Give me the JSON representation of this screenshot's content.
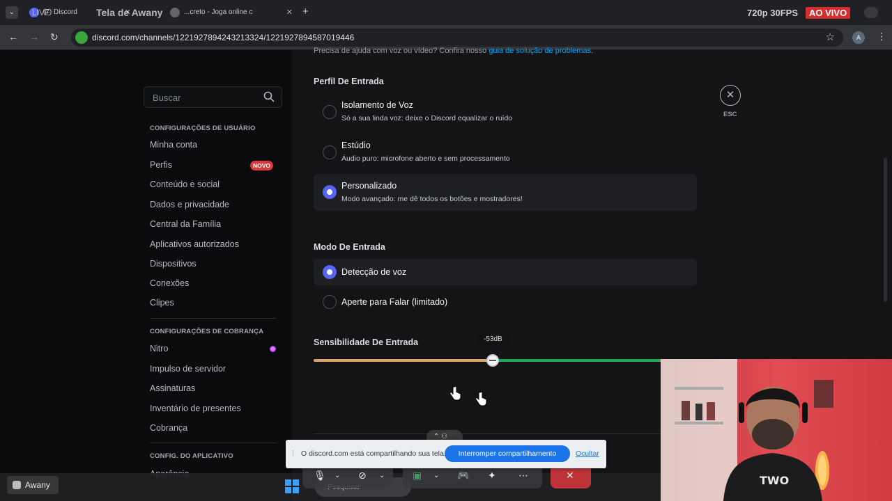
{
  "browser": {
    "live_label": "LIVE",
    "stream_title": "Tela de Awany",
    "tabs": [
      {
        "label": "(7) Discord"
      },
      {
        "label": "..."
      },
      {
        "label": "...creto - Joga online c"
      }
    ],
    "quality": "720p 30FPS",
    "live_badge": "AO VIVO",
    "url": "discord.com/channels/1221927894243213324/1221927894587019446",
    "account_initial": "A",
    "icons": [
      "back-icon",
      "forward-icon",
      "reload-icon",
      "star-icon",
      "kebab-icon"
    ]
  },
  "sidebar": {
    "search_placeholder": "Buscar",
    "sections": [
      {
        "header": "CONFIGURAÇÕES DE USUÁRIO",
        "items": [
          "Minha conta",
          "Perfis",
          "Conteúdo e social",
          "Dados e privacidade",
          "Central da Família",
          "Aplicativos autorizados",
          "Dispositivos",
          "Conexões",
          "Clipes"
        ]
      },
      {
        "header": "CONFIGURAÇÕES DE COBRANÇA",
        "items": [
          "Nitro",
          "Impulso de servidor",
          "Assinaturas",
          "Inventário de presentes",
          "Cobrança"
        ]
      },
      {
        "header": "CONFIG. DO APLICATIVO",
        "items": [
          "Aparência"
        ]
      }
    ],
    "badge_new": "NOVO"
  },
  "main": {
    "help_text": "Precisa de ajuda com voz ou vídeo? Confira nosso ",
    "help_link": "guia de solução de problemas",
    "help_end": ".",
    "input_profile": {
      "label": "Perfil De Entrada",
      "options": [
        {
          "title": "Isolamento de Voz",
          "desc": "Só a sua linda voz: deixe o Discord equalizar o ruído",
          "selected": false
        },
        {
          "title": "Estúdio",
          "desc": "Áudio puro: microfone aberto e sem processamento",
          "selected": false
        },
        {
          "title": "Personalizado",
          "desc": "Modo avançado: me dê todos os botões e mostradores!",
          "selected": true
        }
      ]
    },
    "input_mode": {
      "label": "Modo De Entrada",
      "options": [
        {
          "title": "Detecção de voz",
          "selected": true
        },
        {
          "title": "Aperte para Falar (limitado)",
          "selected": false
        }
      ]
    },
    "sensitivity": {
      "label": "Sensibilidade De Entrada",
      "value_label": "-53dB",
      "thumb_fraction": 0.468,
      "active_fraction": 0.285
    },
    "esc_label": "ESC"
  },
  "share_bar": {
    "message": "O discord.com está compartilhando sua tela.",
    "stop_label": "Interromper compartilhamento",
    "hide_label": "Ocultar"
  },
  "taskbar": {
    "search_placeholder": "Pesquisar",
    "awany_label": "Awany"
  },
  "colors": {
    "accent": "#5865f2",
    "slider_low": "#d8a16a",
    "slider_high": "#23a55a",
    "badge_red": "#da373c",
    "share_blue": "#1a73e8"
  }
}
